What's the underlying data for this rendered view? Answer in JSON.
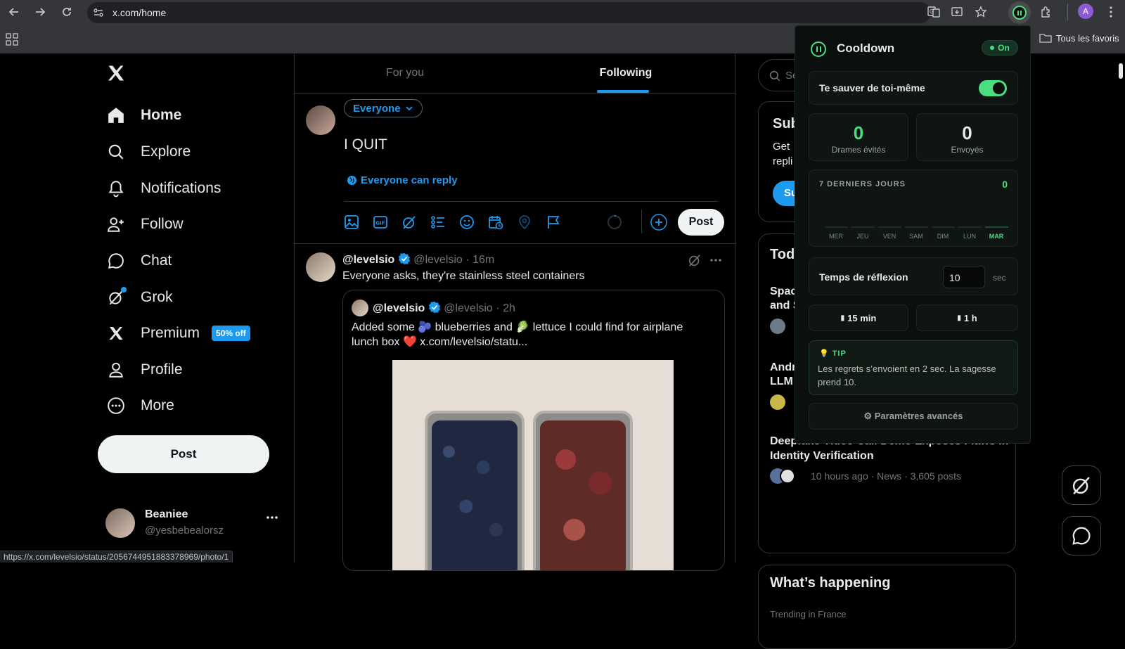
{
  "browser": {
    "url": "x.com/home",
    "profile_initial": "A",
    "bookmarks_folder": "Tous les favoris",
    "status_url": "https://x.com/levelsio/status/2056744951883378969/photo/1"
  },
  "nav": {
    "items": [
      {
        "label": "Home",
        "icon": "home-icon"
      },
      {
        "label": "Explore",
        "icon": "search-icon"
      },
      {
        "label": "Notifications",
        "icon": "bell-icon"
      },
      {
        "label": "Follow",
        "icon": "person-add-icon"
      },
      {
        "label": "Chat",
        "icon": "chat-bubble-icon"
      },
      {
        "label": "Grok",
        "icon": "grok-icon"
      },
      {
        "label": "Premium",
        "icon": "x-logo-icon"
      },
      {
        "label": "Profile",
        "icon": "person-icon"
      },
      {
        "label": "More",
        "icon": "more-circle-icon"
      }
    ],
    "premium_badge": "50% off",
    "post_button": "Post",
    "account": {
      "name": "Beaniee",
      "handle": "@yesbebealorsz"
    }
  },
  "timeline": {
    "tabs": [
      {
        "label": "For you",
        "active": false
      },
      {
        "label": "Following",
        "active": true
      }
    ],
    "composer": {
      "audience": "Everyone",
      "text": "I QUIT",
      "reply_setting": "Everyone can reply",
      "post_button": "Post"
    },
    "tweet": {
      "name": "@levelsio",
      "handle": "@levelsio",
      "time": "16m",
      "text": "Everyone asks, they're stainless steel containers",
      "quote": {
        "name": "@levelsio",
        "handle": "@levelsio",
        "time": "2h",
        "text_1": "Added some 🫐 blueberries and 🥬 lettuce I could find for airplane",
        "text_2": "lunch box ❤️  x.com/levelsio/statu..."
      }
    }
  },
  "sidebar": {
    "search_placeholder": "Se",
    "subscribe": {
      "title": "Sub",
      "line1": "Get",
      "line2": "repli",
      "button": "Su"
    },
    "todays": {
      "title": "Tod"
    },
    "news": [
      {
        "line1": "Spac",
        "line2": "and S"
      },
      {
        "line1": "Andr",
        "line2": "LLM"
      },
      {
        "line1": "Deepfake Video Call Demo Exposes Flaws in",
        "line2": "Identity Verification",
        "meta": "10 hours ago · News · 3,605 posts"
      }
    ],
    "whats_happening": "What’s happening",
    "trending": "Trending in France"
  },
  "extension": {
    "title": "Cooldown",
    "status": "On",
    "toggle_label": "Te sauver de toi-même",
    "toggle_on": true,
    "stats": [
      {
        "value": "0",
        "label": "Drames évités"
      },
      {
        "value": "0",
        "label": "Envoyés"
      }
    ],
    "week_title": "7 DERNIERS JOURS",
    "week_total": "0",
    "days": [
      "MER",
      "JEU",
      "VEN",
      "SAM",
      "DIM",
      "LUN",
      "MAR"
    ],
    "active_day": "MAR",
    "delay_label": "Temps de réflexion",
    "delay_value": "10",
    "delay_unit": "sec",
    "pause_15": "15 min",
    "pause_1h": "1 h",
    "tip_title": "TIP",
    "tip_text_1": "Les regrets s’envoient en 2 sec. La sagesse",
    "tip_text_2": "prend 10.",
    "advanced": "⚙ Paramètres avancés",
    "accent": "#4ade80"
  },
  "colors": {
    "x_blue": "#1d9bf0",
    "bg": "#000000",
    "border": "#2f3336"
  }
}
